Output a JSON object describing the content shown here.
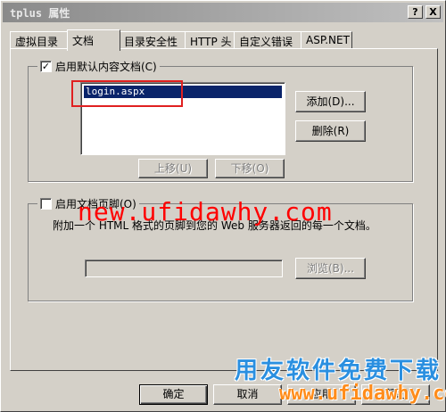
{
  "window": {
    "title": "tplus 属性",
    "help_glyph": "?",
    "close_glyph": "X"
  },
  "tabs": [
    {
      "label": "虚拟目录"
    },
    {
      "label": "文档"
    },
    {
      "label": "目录安全性"
    },
    {
      "label": "HTTP 头"
    },
    {
      "label": "自定义错误"
    },
    {
      "label": "ASP.NET"
    }
  ],
  "default_doc": {
    "checkbox_label": "启用默认内容文档(C)",
    "checked": true,
    "list_items": [
      "login.aspx"
    ],
    "add_button": "添加(D)...",
    "remove_button": "删除(R)",
    "move_up_button": "上移(U)",
    "move_down_button": "下移(O)"
  },
  "footer_doc": {
    "checkbox_label": "启用文档页脚(O)",
    "checked": false,
    "description": "附加一个 HTML 格式的页脚到您的 Web 服务器返回的每一个文档。",
    "path_value": "",
    "browse_button": "浏览(B)..."
  },
  "dialog_buttons": {
    "ok": "确定",
    "cancel": "取消",
    "apply": "应用",
    "help": "帮助"
  },
  "watermarks": {
    "url_red": "new.ufidawhy.com",
    "brand_cn": "用友软件免费下载",
    "url_orange": "www.ufidawhy.com"
  },
  "colors": {
    "dialog_bg": "#d4d0c8",
    "selection": "#0a246a",
    "highlight_box": "#e02020"
  }
}
